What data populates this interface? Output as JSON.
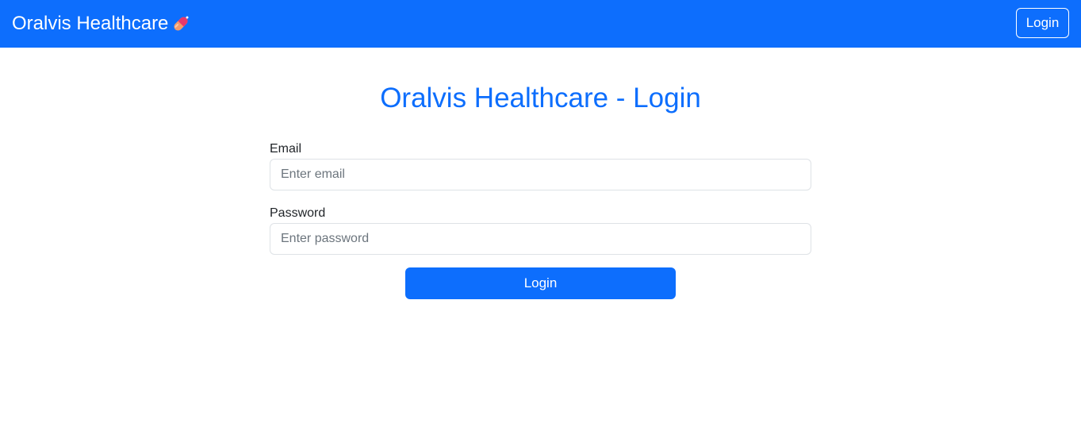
{
  "navbar": {
    "brand": "Oralvis Healthcare",
    "brand_icon": "pill-icon",
    "login_label": "Login",
    "bg_color": "#0d6efd"
  },
  "page": {
    "title": "Oralvis Healthcare - Login"
  },
  "form": {
    "email_label": "Email",
    "email_placeholder": "Enter email",
    "email_value": "",
    "password_label": "Password",
    "password_placeholder": "Enter password",
    "password_value": "",
    "submit_label": "Login"
  },
  "colors": {
    "primary": "#0d6efd",
    "text": "#212529",
    "border": "#dee2e6"
  }
}
